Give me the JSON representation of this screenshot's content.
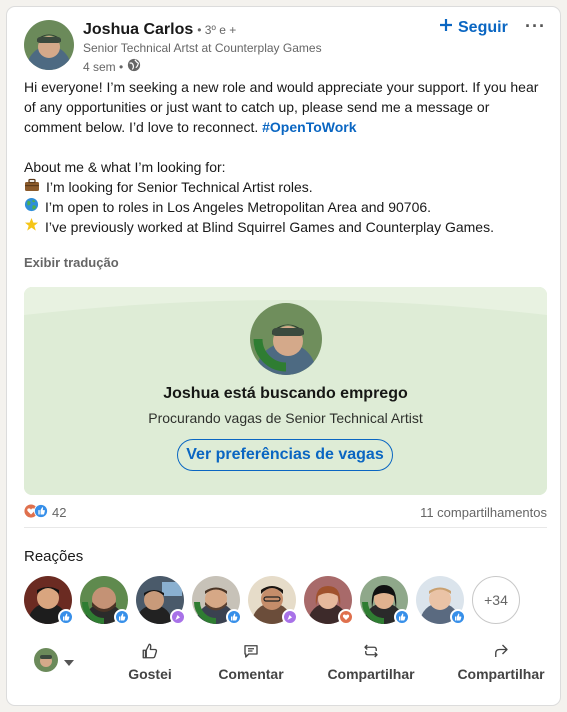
{
  "post": {
    "author": {
      "name": "Joshua Carlos",
      "degree": "• 3º e +",
      "headline": "Senior Technical Artst at Counterplay Games",
      "time": "4 sem •"
    },
    "follow_label": "Seguir",
    "more_label": "···",
    "body": {
      "intro": "Hi everyone! I’m seeking a new role and would appreciate your support. If you hear of any opportunities or just want to catch up, please send me a message or comment below. I’d love to reconnect.",
      "hashtag": "#OpenToWork",
      "about_heading": "About me & what I’m looking for:",
      "line1": "I’m looking for Senior Technical Artist roles.",
      "line2": "I’m open to roles in Los Angeles Metropolitan Area and 90706.",
      "line3": "I’ve previously worked at Blind Squirrel Games and Counterplay Games."
    },
    "see_translation": "Exibir tradução",
    "open_to_work": {
      "title": "Joshua está buscando emprego",
      "subtitle": "Procurando vagas de Senior Technical Artist",
      "button": "Ver preferências de vagas"
    },
    "reaction_count": "42",
    "shares": "11 compartilhamentos",
    "reactions_title": "Reações",
    "more_reactors": "+34",
    "actions": {
      "like": "Gostei",
      "comment": "Comentar",
      "share": "Compartilhar",
      "send": "Compartilhar"
    }
  },
  "colors": {
    "accent": "#0a66c2",
    "otw_background": "#deecd6",
    "like_badge": "#378fe9",
    "love_badge": "#df704d"
  },
  "icons": [
    "globe-icon",
    "plus-icon",
    "briefcase-icon",
    "globe-earth-icon",
    "star-icon",
    "like-icon",
    "comment-icon",
    "repost-icon",
    "send-icon",
    "caret-down-icon"
  ]
}
